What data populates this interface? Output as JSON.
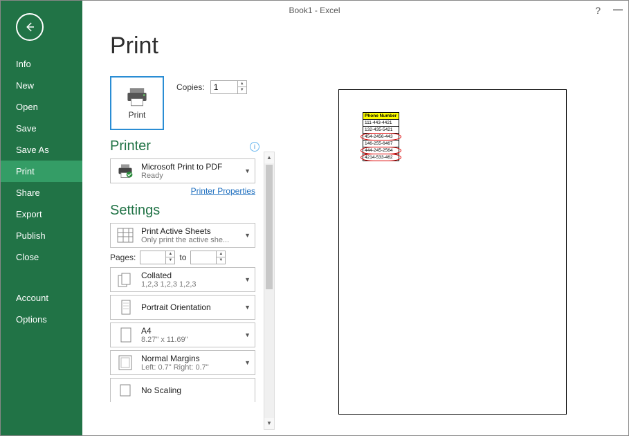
{
  "window": {
    "title": "Book1 - Excel"
  },
  "sidebar": {
    "items": [
      "Info",
      "New",
      "Open",
      "Save",
      "Save As",
      "Print",
      "Share",
      "Export",
      "Publish",
      "Close"
    ],
    "selected": "Print",
    "bottom": [
      "Account",
      "Options"
    ]
  },
  "page": {
    "title": "Print"
  },
  "print_button": {
    "label": "Print"
  },
  "copies": {
    "label": "Copies:",
    "value": "1"
  },
  "printer": {
    "heading": "Printer",
    "name": "Microsoft Print to PDF",
    "status": "Ready",
    "properties_link": "Printer Properties"
  },
  "settings": {
    "heading": "Settings",
    "print_what": {
      "line1": "Print Active Sheets",
      "line2": "Only print the active she..."
    },
    "pages_label": "Pages:",
    "pages_to": "to",
    "collate": {
      "line1": "Collated",
      "line2": "1,2,3    1,2,3    1,2,3"
    },
    "orientation": {
      "line1": "Portrait Orientation",
      "line2": ""
    },
    "paper": {
      "line1": "A4",
      "line2": "8.27\" x 11.69\""
    },
    "margins": {
      "line1": "Normal Margins",
      "line2": "Left:  0.7\"    Right:  0.7\""
    },
    "scaling": {
      "line1": "No Scaling",
      "line2": ""
    }
  },
  "preview_table": {
    "header": "Phone Number",
    "rows": [
      {
        "text": "111-443-4421",
        "circled": false
      },
      {
        "text": "132-435-5421",
        "circled": false
      },
      {
        "text": "454-2456-443",
        "circled": true
      },
      {
        "text": "146-255-6467",
        "circled": false
      },
      {
        "text": "444-245-2564",
        "circled": true
      },
      {
        "text": "4214-533-462",
        "circled": true
      }
    ]
  }
}
